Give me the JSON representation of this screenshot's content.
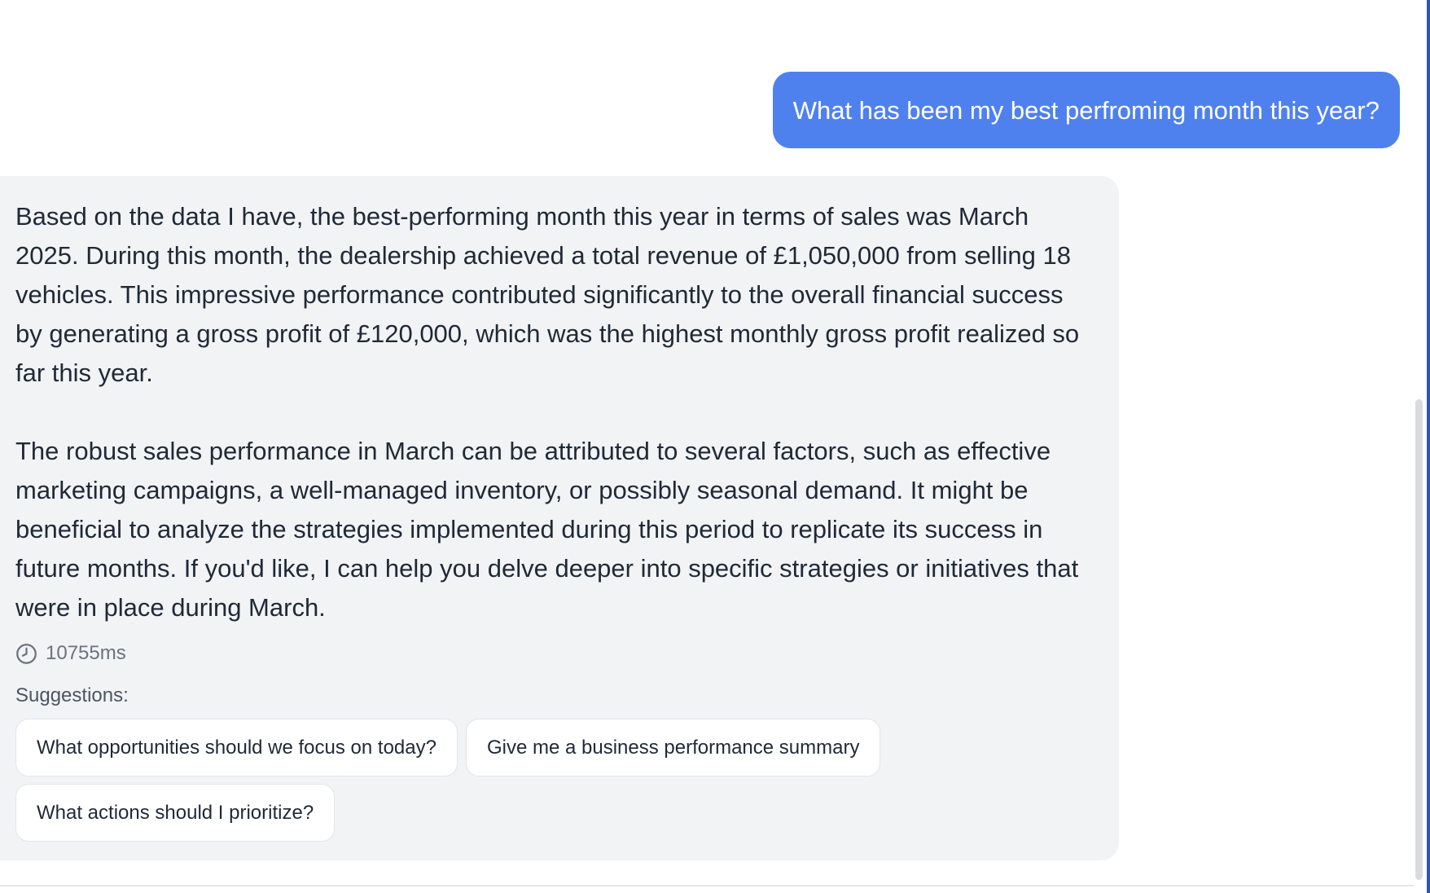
{
  "conversation": {
    "user_message": "What has been my best perfroming month this year?",
    "assistant_paragraphs": [
      "Based on the data I have, the best-performing month this year in terms of sales was March 2025. During this month, the dealership achieved a total revenue of £1,050,000 from selling 18 vehicles. This impressive performance contributed significantly to the overall financial success by generating a gross profit of £120,000, which was the highest monthly gross profit realized so far this year.",
      "The robust sales performance in March can be attributed to several factors, such as effective marketing campaigns, a well-managed inventory, or possibly seasonal demand. It might be beneficial to analyze the strategies implemented during this period to replicate its success in future months. If you'd like, I can help you delve deeper into specific strategies or initiatives that were in place during March."
    ],
    "response_time": "10755ms",
    "response_time_icon": "clock-icon",
    "suggestions_label": "Suggestions:",
    "suggestions": [
      "What opportunities should we focus on today?",
      "Give me a business performance summary",
      "What actions should I prioritize?"
    ]
  },
  "colors": {
    "user_bubble": "#4f81ee",
    "assistant_bubble": "#f2f3f5",
    "text": "#1f2937",
    "muted_text": "#6b7280"
  }
}
